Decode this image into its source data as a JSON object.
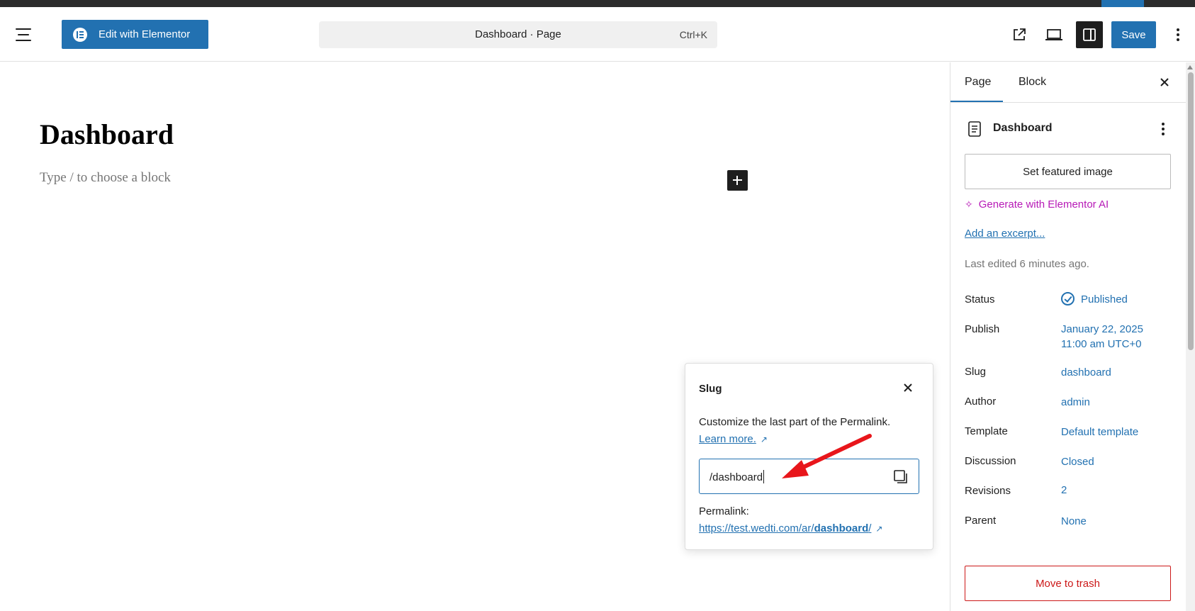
{
  "header": {
    "edit_elementor_label": "Edit with Elementor",
    "command_title": "Dashboard · Page",
    "command_shortcut": "Ctrl+K",
    "save_label": "Save"
  },
  "canvas": {
    "page_title": "Dashboard",
    "block_placeholder": "Type / to choose a block"
  },
  "slug_popover": {
    "title": "Slug",
    "description": "Customize the last part of the Permalink.",
    "learn_more": "Learn more.",
    "input_value": "/dashboard",
    "permalink_label": "Permalink:",
    "permalink_prefix": "https://test.wedti.com/ar/",
    "permalink_slug": "dashboard",
    "permalink_suffix": "/"
  },
  "sidebar": {
    "tabs": [
      {
        "label": "Page",
        "active": true
      },
      {
        "label": "Block",
        "active": false
      }
    ],
    "document_title": "Dashboard",
    "featured_image_label": "Set featured image",
    "generate_ai_label": "Generate with Elementor AI",
    "excerpt_label": "Add an excerpt...",
    "last_edited": "Last edited 6 minutes ago.",
    "properties": [
      {
        "label": "Status",
        "value": "Published"
      },
      {
        "label": "Publish",
        "value": "January 22, 2025",
        "value2": "11:00 am UTC+0"
      },
      {
        "label": "Slug",
        "value": "dashboard"
      },
      {
        "label": "Author",
        "value": "admin"
      },
      {
        "label": "Template",
        "value": "Default template"
      },
      {
        "label": "Discussion",
        "value": "Closed"
      },
      {
        "label": "Revisions",
        "value": "2"
      },
      {
        "label": "Parent",
        "value": "None"
      }
    ],
    "trash_label": "Move to trash"
  },
  "colors": {
    "accent": "#2271b1",
    "ai_magenta": "#b71ab7",
    "danger": "#cc1818",
    "annotation_arrow": "#e8161b"
  },
  "icons": [
    "hamburger-icon",
    "elementor-logo-icon",
    "external-link-icon",
    "desktop-preview-icon",
    "sidebar-toggle-icon",
    "more-vertical-icon",
    "plus-icon",
    "close-icon",
    "copy-icon",
    "page-document-icon",
    "sparkle-icon",
    "published-check-icon"
  ]
}
